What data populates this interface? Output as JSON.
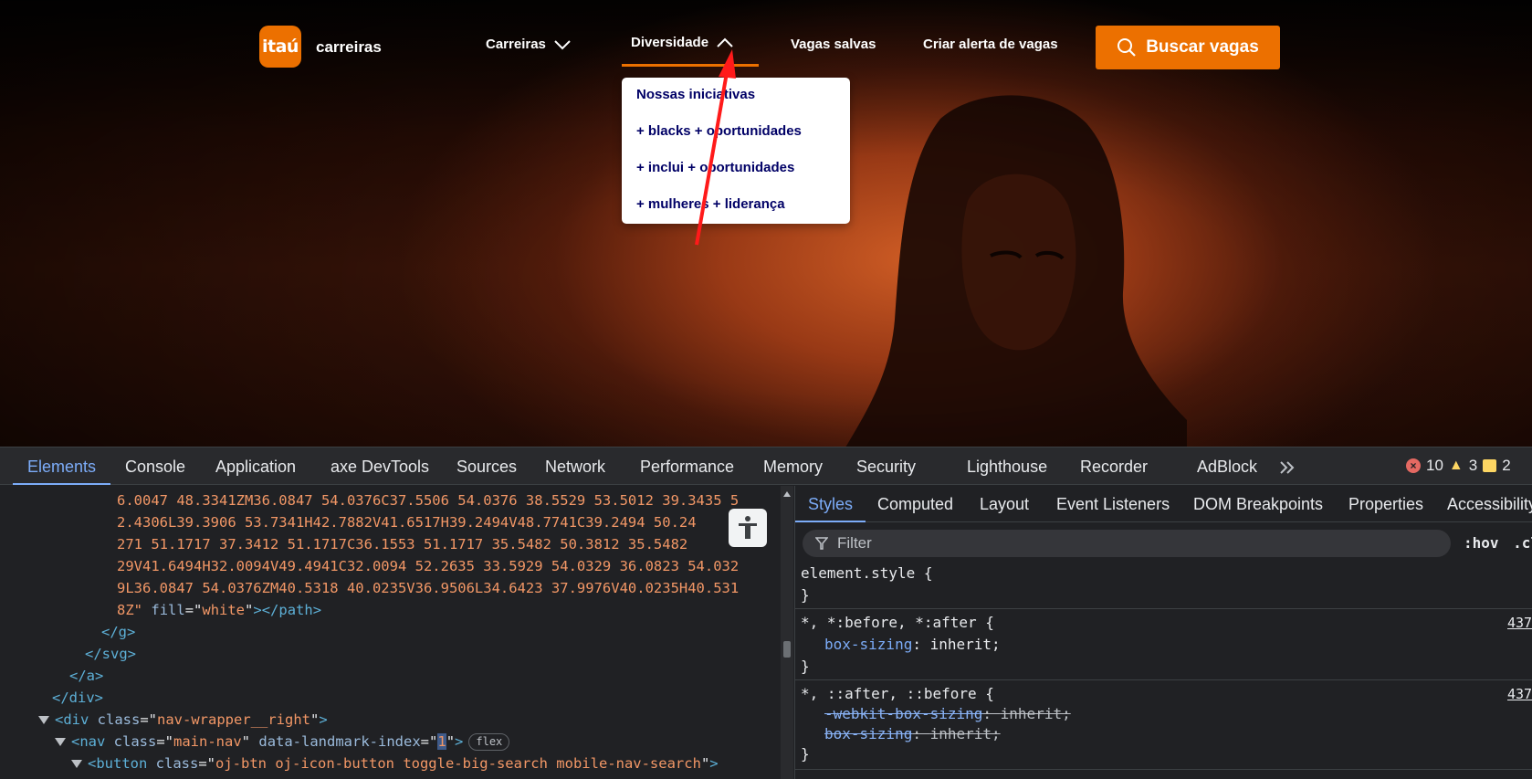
{
  "site": {
    "logo_text": "itaú",
    "brand": "carreiras",
    "nav": {
      "carreiras": "Carreiras",
      "diversidade": "Diversidade",
      "vagas_salvas": "Vagas salvas",
      "criar_alerta": "Criar alerta de vagas"
    },
    "search_button": "Buscar vagas",
    "dropdown": [
      "Nossas iniciativas",
      "+ blacks + oportunidades",
      "+ inclui + oportunidades",
      "+ mulheres + liderança"
    ],
    "colors": {
      "accent": "#ec7000",
      "dropdown_text": "#000066"
    }
  },
  "devtools": {
    "tabs": [
      "Elements",
      "Console",
      "Application",
      "axe DevTools",
      "Sources",
      "Network",
      "Performance",
      "Memory",
      "Security",
      "Lighthouse",
      "Recorder",
      "AdBlock"
    ],
    "more_tabs_icon": "double-chevron-icon",
    "counts": {
      "errors": "10",
      "warnings": "3",
      "issues": "2"
    },
    "elements_lines": [
      "6.0047 48.3341ZM36.0847 54.0376C37.5506 54.0376 38.5529 53.5012 39.3435 5",
      "2.4306L39.3906 53.7341H42.7882V41.6517H39.2494V48.7741C39.2494 50.24",
      "271 51.1717 37.3412 51.1717C36.1553 51.1717 35.5482 50.3812 35.5482",
      "29V41.6494H32.0094V49.4941C32.0094 52.2635 33.5929 54.0329 36.0823 54.032",
      "9L36.0847 54.0376ZM40.5318 40.0235V36.9506L34.6423 37.9976V40.0235H40.531",
      "8Z"
    ],
    "elements_tags": {
      "fill_attr": "fill",
      "fill_val": "white",
      "path_close": "></path>",
      "g_close": "</g>",
      "svg_close": "</svg>",
      "a_close": "</a>",
      "div_close": "</div>",
      "div_tag": "<div",
      "div_class_attr": "class",
      "div_class_val": "nav-wrapper__right",
      "nav_tag": "<nav",
      "nav_class_attr": "class",
      "nav_class_val": "main-nav",
      "nav_landmark_attr": "data-landmark-index",
      "nav_landmark_val": "1",
      "flex_badge": "flex",
      "button_tag": "<button",
      "button_class_attr": "class",
      "button_class_val": "oj-btn oj-icon-button toggle-big-search mobile-nav-search"
    },
    "styles_tabs": [
      "Styles",
      "Computed",
      "Layout",
      "Event Listeners",
      "DOM Breakpoints",
      "Properties",
      "Accessibility"
    ],
    "filter_placeholder": "Filter",
    "hov": ":hov",
    "cls": ".cls",
    "rules": {
      "element_style": "element.style {",
      "close": "}",
      "rule1_selector": "*, *:before, *:after {",
      "rule1_prop": "box-sizing",
      "rule1_val": "inherit;",
      "rule1_src": "437",
      "rule2_selector": "*, ::after, ::before {",
      "rule2_prop1": "-webkit-box-sizing",
      "rule2_val1": "inherit;",
      "rule2_prop2": "box-sizing",
      "rule2_val2": "inherit;",
      "rule2_src": "437"
    }
  }
}
